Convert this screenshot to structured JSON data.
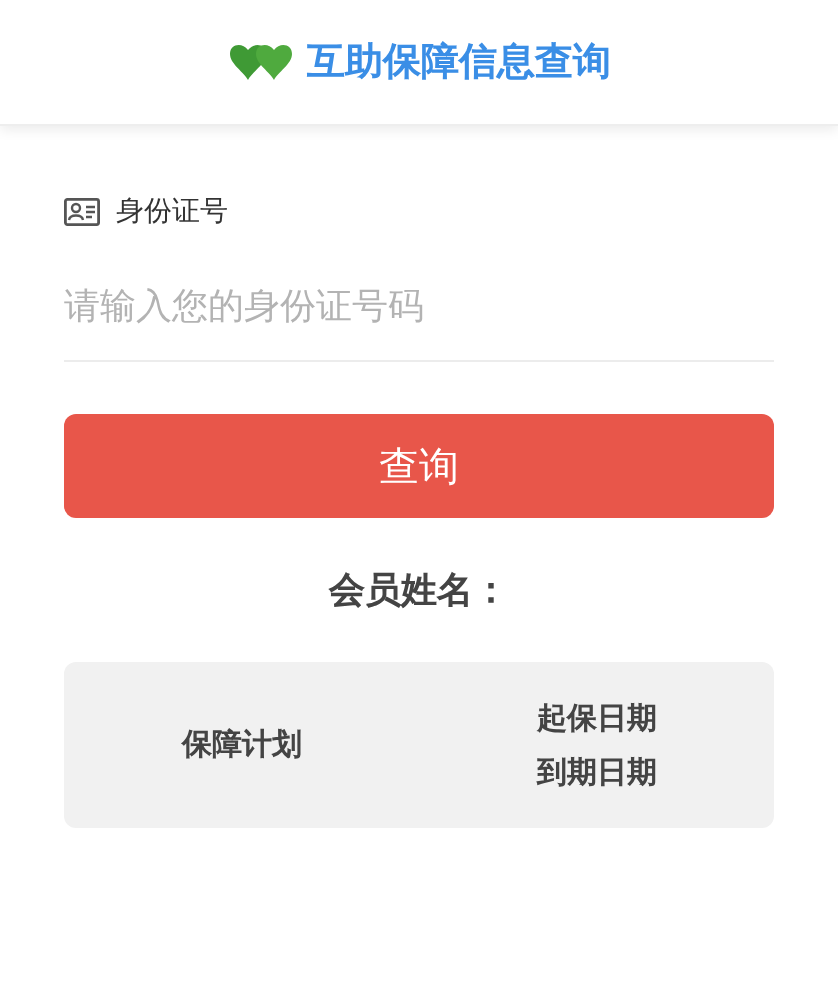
{
  "header": {
    "title": "互助保障信息查询"
  },
  "id_field": {
    "label": "身份证号",
    "placeholder": "请输入您的身份证号码"
  },
  "query_button": "查询",
  "member_name_label": "会员姓名：",
  "table": {
    "column_1": "保障计划",
    "column_2": [
      "起保日期",
      "到期日期"
    ]
  }
}
